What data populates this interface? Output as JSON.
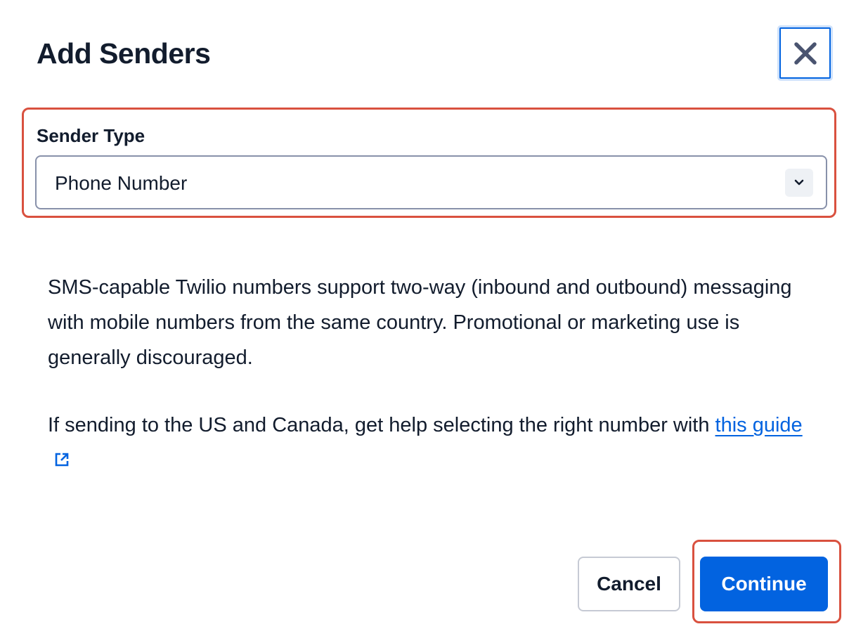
{
  "modal": {
    "title": "Add Senders",
    "close_icon": "close-icon"
  },
  "sender_type": {
    "label": "Sender Type",
    "selected": "Phone Number",
    "chevron_icon": "chevron-down-icon"
  },
  "description": {
    "paragraph1": "SMS-capable Twilio numbers support two-way (inbound and outbound) messaging with mobile numbers from the same country. Promotional or marketing use is generally discouraged.",
    "paragraph2_text": "If sending to the US and Canada, get help selecting the right number with ",
    "paragraph2_link": "this guide",
    "link_icon": "external-link-icon"
  },
  "footer": {
    "cancel_label": "Cancel",
    "continue_label": "Continue"
  },
  "colors": {
    "primary": "#0263e0",
    "highlight": "#d9513f",
    "text": "#121c2d"
  }
}
